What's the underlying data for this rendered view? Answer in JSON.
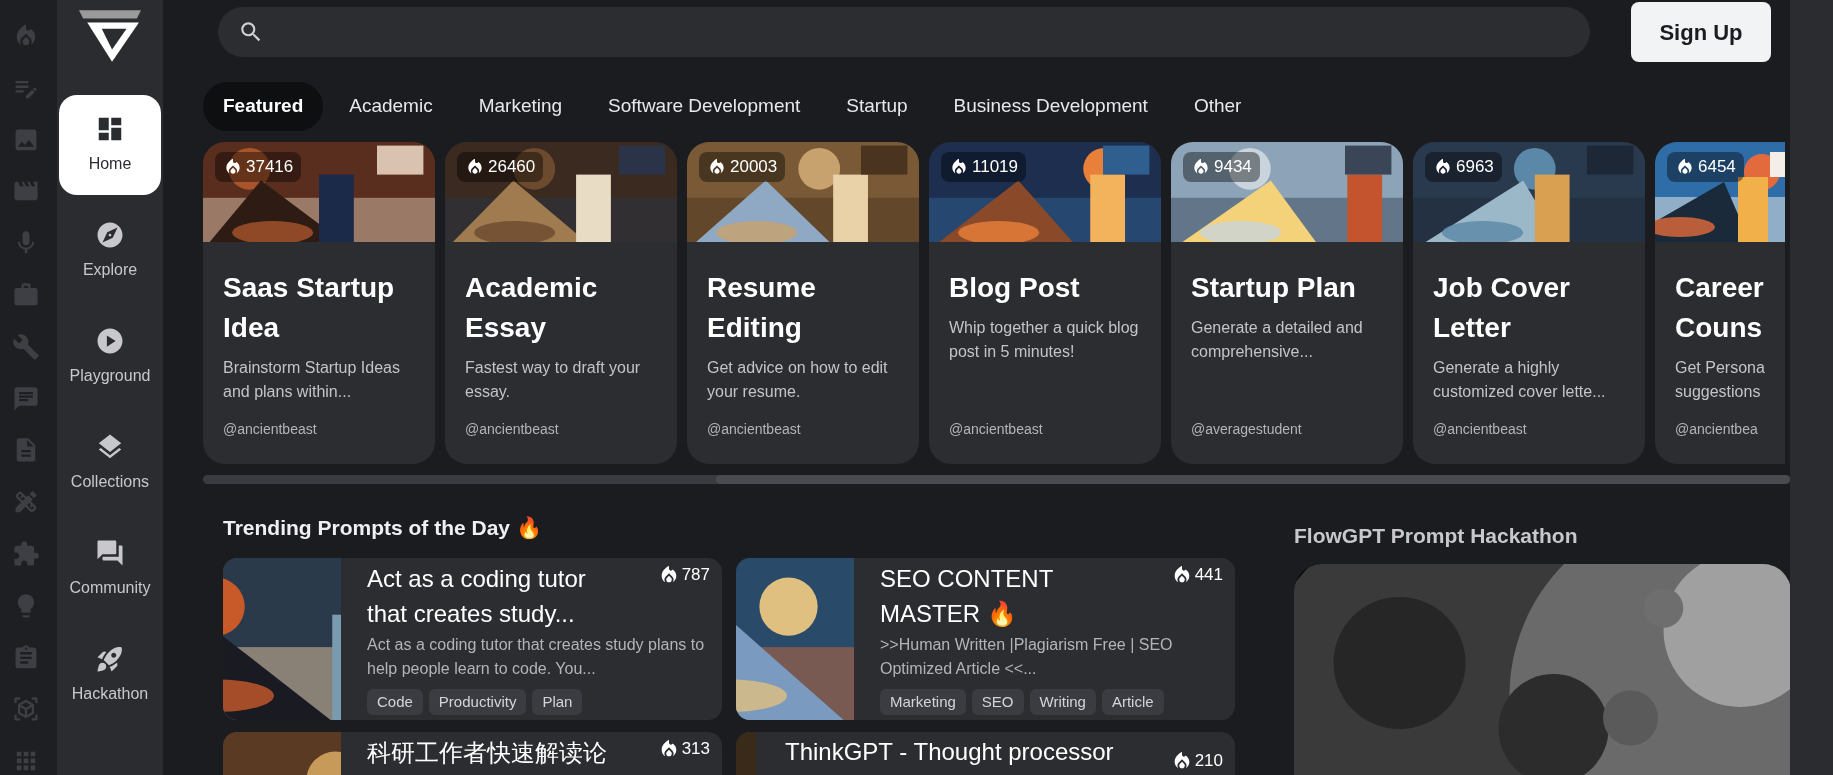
{
  "sidebar": {
    "items": [
      {
        "label": "Home",
        "selected": true
      },
      {
        "label": "Explore",
        "selected": false
      },
      {
        "label": "Playground",
        "selected": false
      },
      {
        "label": "Collections",
        "selected": false
      },
      {
        "label": "Community",
        "selected": false
      },
      {
        "label": "Hackathon",
        "selected": false
      }
    ]
  },
  "sign_up_button": "Sign Up",
  "tabs": [
    {
      "label": "Featured",
      "selected": true
    },
    {
      "label": "Academic",
      "selected": false
    },
    {
      "label": "Marketing",
      "selected": false
    },
    {
      "label": "Software Development",
      "selected": false
    },
    {
      "label": "Startup",
      "selected": false
    },
    {
      "label": "Business Development",
      "selected": false
    },
    {
      "label": "Other",
      "selected": false
    }
  ],
  "featured_cards": [
    {
      "count": "37416",
      "title": "Saas Startup Idea",
      "description": "Brainstorm Startup Ideas and plans within...",
      "author": "@ancientbeast"
    },
    {
      "count": "26460",
      "title": "Academic Essay",
      "description": "Fastest way to draft your essay.",
      "author": "@ancientbeast"
    },
    {
      "count": "20003",
      "title": "Resume Editing",
      "description": "Get advice on how to edit your resume.",
      "author": "@ancientbeast"
    },
    {
      "count": "11019",
      "title": "Blog Post",
      "description": "Whip together a quick blog post in 5 minutes!",
      "author": "@ancientbeast"
    },
    {
      "count": "9434",
      "title": "Startup Plan",
      "description": "Generate a detailed and comprehensive...",
      "author": "@averagestudent"
    },
    {
      "count": "6963",
      "title": "Job Cover Letter",
      "description": "Generate a highly customized cover lette...",
      "author": "@ancientbeast"
    },
    {
      "count": "6454",
      "title": "Career Couns",
      "description": "Get Persona suggestions",
      "author": "@ancientbea"
    }
  ],
  "trending": {
    "title": "Trending Prompts of the Day 🔥",
    "prompts": [
      {
        "kind": "wide",
        "count": "787",
        "title": "Act as a coding tutor that creates study...",
        "description": "Act as a coding tutor that creates study plans to help people learn to code. You...",
        "tags": [
          "Code",
          "Productivity",
          "Plan"
        ]
      },
      {
        "kind": "wide",
        "count": "441",
        "title": "SEO CONTENT MASTER 🔥",
        "description": ">>Human Written |Plagiarism Free | SEO Optimized Article <<...",
        "tags": [
          "Marketing",
          "SEO",
          "Writing",
          "Article"
        ]
      },
      {
        "kind": "wide",
        "count": "313",
        "title": "科研工作者快速解读论"
      },
      {
        "kind": "narrow",
        "count": "210",
        "title": "ThinkGPT - Thought processor"
      }
    ]
  },
  "hackathon": {
    "title": "FlowGPT Prompt Hackathon"
  }
}
